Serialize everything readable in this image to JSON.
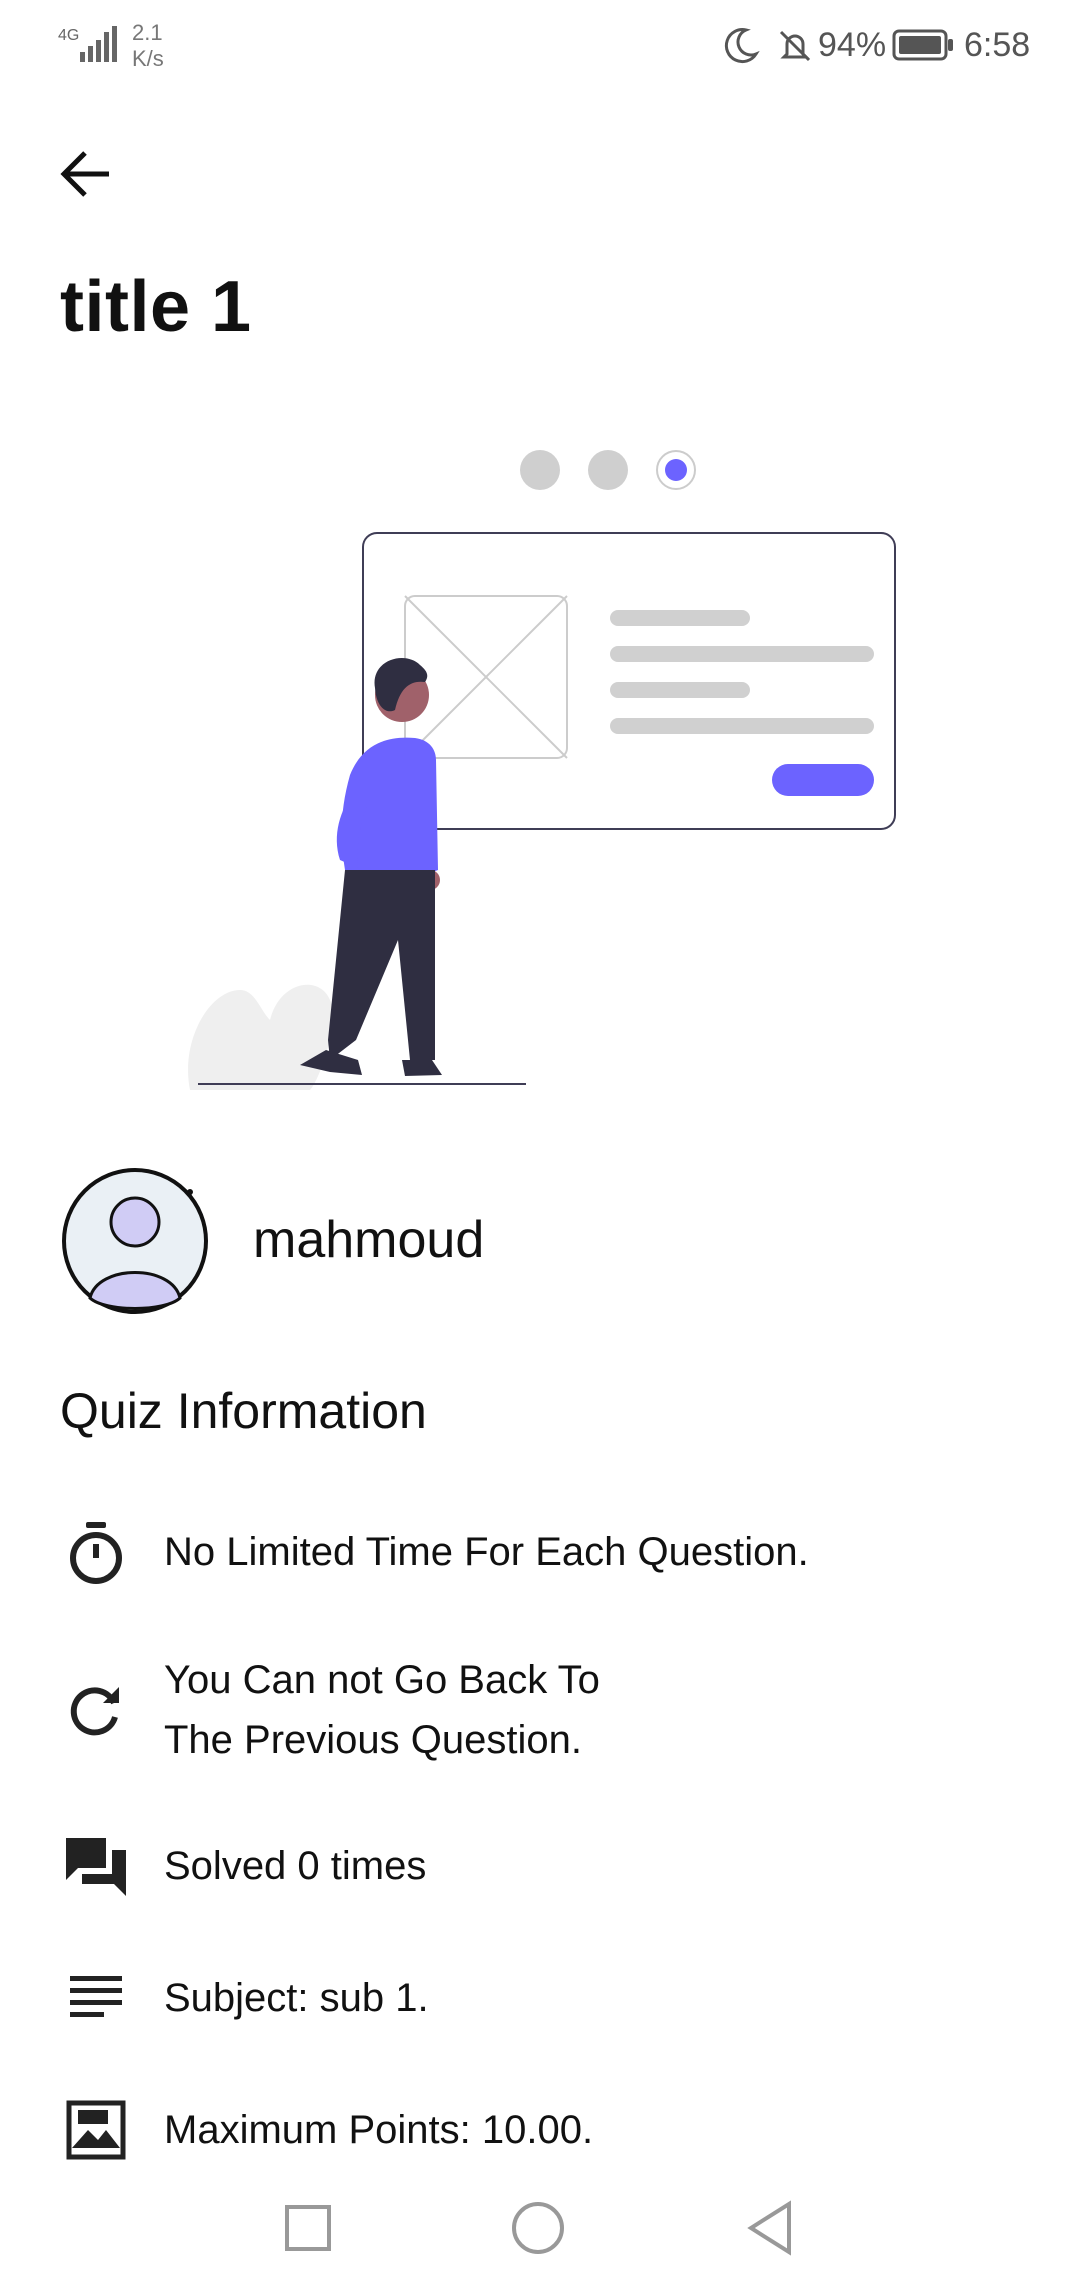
{
  "status_bar": {
    "network": "4G",
    "speed_value": "2.1",
    "speed_unit": "K/s",
    "battery": "94%",
    "time": "6:58"
  },
  "header": {
    "title": "title 1"
  },
  "carousel": {
    "total": 3,
    "active_index": 2,
    "active_color": "#6c63ff"
  },
  "author": {
    "name": "mahmoud"
  },
  "quiz_info": {
    "heading": "Quiz Information",
    "items": [
      {
        "icon": "timer-icon",
        "text": "No Limited Time For Each Question."
      },
      {
        "icon": "refresh-icon",
        "text": "You Can not Go Back To\nThe Previous Question."
      },
      {
        "icon": "chat-icon",
        "text": "Solved 0 times"
      },
      {
        "icon": "lines-icon",
        "text": "Subject: sub 1."
      },
      {
        "icon": "image-icon",
        "text": "Maximum Points: 10.00."
      }
    ]
  }
}
